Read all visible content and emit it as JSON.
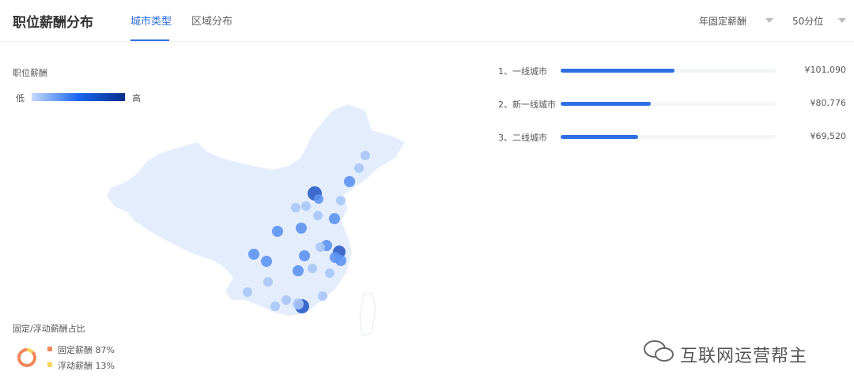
{
  "header": {
    "title": "职位薪酬分布",
    "tabs": [
      {
        "label": "城市类型",
        "active": true
      },
      {
        "label": "区域分布",
        "active": false
      }
    ],
    "selects": [
      {
        "value": "年固定薪酬"
      },
      {
        "value": "50分位"
      }
    ]
  },
  "map": {
    "legend_title": "职位薪酬",
    "low": "低",
    "high": "高",
    "colors": {
      "low": "#c5d9fb",
      "mid": "#1a66f0",
      "high": "#0a2f8a"
    }
  },
  "ranking": [
    {
      "label": "1、一线城市",
      "value": "¥101,090",
      "fraction": 0.53
    },
    {
      "label": "2、新一线城市",
      "value": "¥80,776",
      "fraction": 0.42
    },
    {
      "label": "3、二线城市",
      "value": "¥69,520",
      "fraction": 0.36
    }
  ],
  "ratio": {
    "title": "固定/浮动薪酬占比",
    "items": [
      {
        "label": "固定薪酬 87%",
        "percent": 87,
        "color": "#f4875c"
      },
      {
        "label": "浮动薪酬 13%",
        "percent": 13,
        "color": "#f9d65a"
      }
    ]
  },
  "watermark": "互联网运营帮主"
}
